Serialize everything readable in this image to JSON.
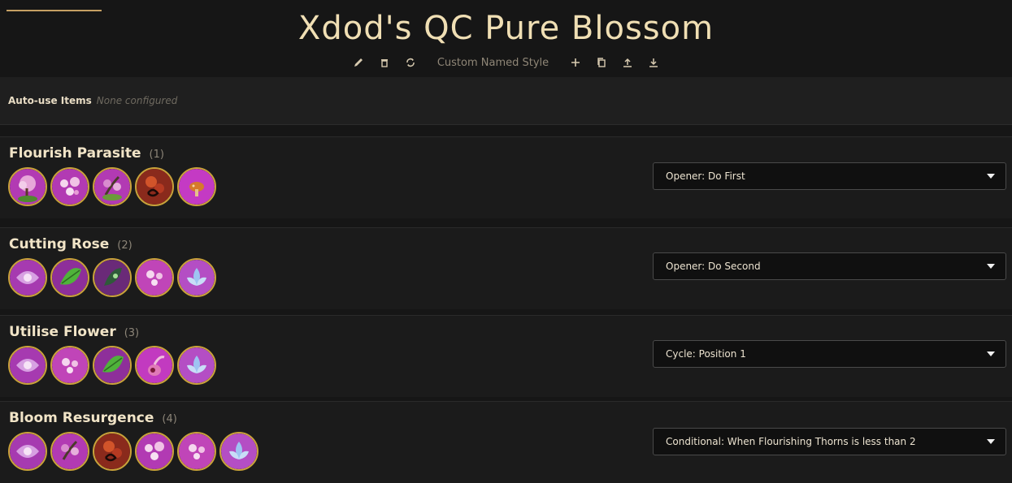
{
  "header": {
    "title": "Xdod's QC Pure Blossom",
    "toolbar": {
      "style_name": "Custom Named Style",
      "icons": [
        "pencil-icon",
        "trash-icon",
        "refresh-icon",
        "plus-icon",
        "copy-icon",
        "upload-icon",
        "download-icon"
      ]
    }
  },
  "auto_use": {
    "label": "Auto-use Items",
    "value": "None configured"
  },
  "steps": [
    {
      "name": "Flourish Parasite",
      "number": "(1)",
      "condition": "Opener: Do First",
      "abilities": [
        "tree-ability-icon",
        "blossom-ability-icon",
        "tree-ability-icon",
        "fire-swirl-ability-icon",
        "mushroom-ability-icon"
      ]
    },
    {
      "name": "Cutting Rose",
      "number": "(2)",
      "condition": "Opener: Do Second",
      "abilities": [
        "petal-swirl-ability-icon",
        "green-leaf-ability-icon",
        "dark-leaf-ability-icon",
        "blossom-ability-icon",
        "lotus-ability-icon"
      ]
    },
    {
      "name": "Utilise Flower",
      "number": "(3)",
      "condition": "Cycle: Position 1",
      "abilities": [
        "petal-swirl-ability-icon",
        "blossom-ability-icon",
        "green-leaf-ability-icon",
        "pitcher-ability-icon",
        "lotus-ability-icon"
      ]
    },
    {
      "name": "Bloom Resurgence",
      "number": "(4)",
      "condition": "Conditional: When Flourishing Thorns is less than 2",
      "abilities": [
        "petal-swirl-ability-icon",
        "tree-ability-icon",
        "fire-swirl-ability-icon",
        "blossom-ability-icon",
        "blossom-ability-icon",
        "lotus-ability-icon"
      ]
    }
  ],
  "colors": {
    "accent": "#c6a063",
    "icon_background": "#b23ab3",
    "icon_border": "#c9a23a",
    "background": "#161616"
  }
}
